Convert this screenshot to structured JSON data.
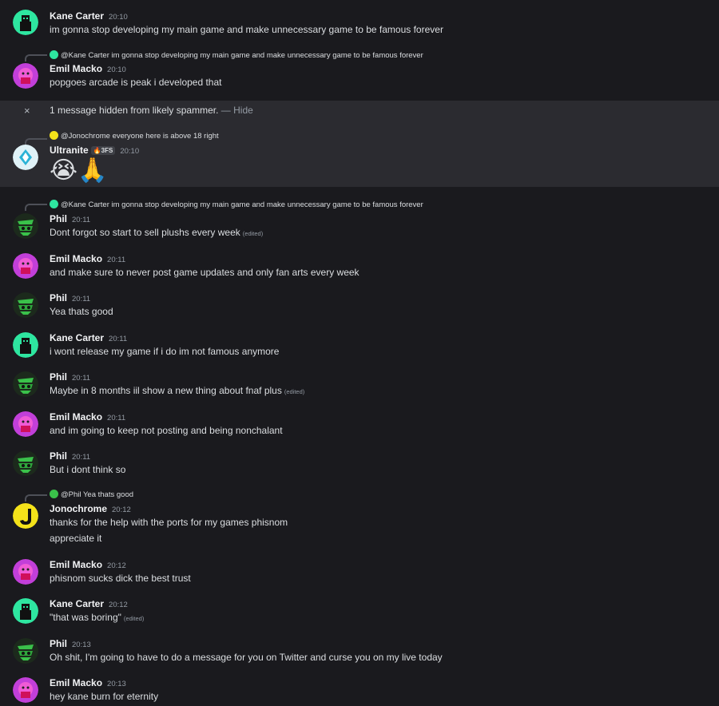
{
  "hidden_notice": {
    "close_glyph": "×",
    "text": "1 message hidden from likely spammer.",
    "separator": "—",
    "hide_label": "Hide"
  },
  "messages": [
    {
      "author": "Kane Carter",
      "time": "20:10",
      "text": "im gonna stop developing my main game and make unnecessary game to be famous forever"
    },
    {
      "reply_to": {
        "name": "@Kane Carter",
        "text": "im gonna stop developing my main game and make unnecessary game to be famous forever"
      },
      "author": "Emil Macko",
      "time": "20:10",
      "text": "popgoes arcade is peak i developed that"
    },
    {
      "reply_to": {
        "name": "@Jonochrome",
        "text": "everyone here is above 18 right"
      },
      "author": "Ultranite",
      "badge": "3FS",
      "time": "20:10",
      "emoji": [
        "😭",
        "🙏"
      ]
    },
    {
      "reply_to": {
        "name": "@Kane Carter",
        "text": "im gonna stop developing my main game and make unnecessary game to be famous forever"
      },
      "author": "Phil",
      "time": "20:11",
      "text": "Dont forgot so start to sell plushs every week",
      "edited": "(edited)"
    },
    {
      "author": "Emil Macko",
      "time": "20:11",
      "text": "and make sure to never post game updates and only fan arts every week"
    },
    {
      "author": "Phil",
      "time": "20:11",
      "text": "Yea thats good"
    },
    {
      "author": "Kane Carter",
      "time": "20:11",
      "text": "i wont release my game  if i do im not famous anymore"
    },
    {
      "author": "Phil",
      "time": "20:11",
      "text": "Maybe in 8 months iil show a new thing about fnaf plus",
      "edited": "(edited)"
    },
    {
      "author": "Emil Macko",
      "time": "20:11",
      "text": "and im going to keep not posting and being nonchalant"
    },
    {
      "author": "Phil",
      "time": "20:11",
      "text": "But i dont think so"
    },
    {
      "reply_to": {
        "name": "@Phil",
        "text": "Yea thats good"
      },
      "author": "Jonochrome",
      "time": "20:12",
      "text": "thanks for the help with the ports for my games phisnom",
      "text2": "appreciate it"
    },
    {
      "author": "Emil Macko",
      "time": "20:12",
      "text": "phisnom sucks dick the best trust"
    },
    {
      "author": "Kane Carter",
      "time": "20:12",
      "text": "\"that was boring\"",
      "edited": "(edited)"
    },
    {
      "author": "Phil",
      "time": "20:13",
      "text": "Oh shit, I'm going to have to do a message for you on Twitter  and curse you on my live today"
    },
    {
      "author": "Emil Macko",
      "time": "20:13",
      "text": "hey kane burn for eternity"
    }
  ],
  "colors": {
    "background": "#1a1a1e",
    "hidden_block": "#2b2b30",
    "kane": "#2ee6a0",
    "emil": "#e84fd6",
    "phil": "#3ac14a",
    "ultranite": "#e0f2f7",
    "jonochrome": "#f4e21a"
  }
}
